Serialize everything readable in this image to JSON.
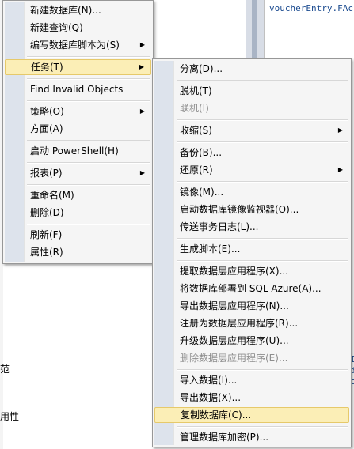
{
  "background": {
    "code_text": "voucherEntry.FAc",
    "left_fragments": [
      "范",
      "用性"
    ],
    "right_fragments": [
      "I",
      "d",
      "c"
    ]
  },
  "main_menu": {
    "items": [
      {
        "label": "新建数据库(N)...",
        "submenu": false
      },
      {
        "label": "新建查询(Q)",
        "submenu": false
      },
      {
        "label": "编写数据库脚本为(S)",
        "submenu": true
      },
      {
        "label": "任务(T)",
        "submenu": true,
        "highlighted": true
      },
      {
        "label": "Find Invalid Objects",
        "submenu": false
      },
      {
        "label": "策略(O)",
        "submenu": true
      },
      {
        "label": "方面(A)",
        "submenu": false
      },
      {
        "label": "启动 PowerShell(H)",
        "submenu": false
      },
      {
        "label": "报表(P)",
        "submenu": true
      },
      {
        "label": "重命名(M)",
        "submenu": false
      },
      {
        "label": "删除(D)",
        "submenu": false
      },
      {
        "label": "刷新(F)",
        "submenu": false
      },
      {
        "label": "属性(R)",
        "submenu": false
      }
    ]
  },
  "tasks_menu": {
    "items": [
      {
        "label": "分离(D)...",
        "enabled": true
      },
      {
        "label": "脱机(T)",
        "enabled": true
      },
      {
        "label": "联机(I)",
        "enabled": false
      },
      {
        "label": "收缩(S)",
        "enabled": true,
        "submenu": true
      },
      {
        "label": "备份(B)...",
        "enabled": true
      },
      {
        "label": "还原(R)",
        "enabled": true,
        "submenu": true
      },
      {
        "label": "镜像(M)...",
        "enabled": true
      },
      {
        "label": "启动数据库镜像监视器(O)...",
        "enabled": true
      },
      {
        "label": "传送事务日志(L)...",
        "enabled": true
      },
      {
        "label": "生成脚本(E)...",
        "enabled": true
      },
      {
        "label": "提取数据层应用程序(X)...",
        "enabled": true
      },
      {
        "label": "将数据库部署到 SQL Azure(A)...",
        "enabled": true
      },
      {
        "label": "导出数据层应用程序(N)...",
        "enabled": true
      },
      {
        "label": "注册为数据层应用程序(R)...",
        "enabled": true
      },
      {
        "label": "升级数据层应用程序(U)...",
        "enabled": true
      },
      {
        "label": "删除数据层应用程序(E)...",
        "enabled": false
      },
      {
        "label": "导入数据(I)...",
        "enabled": true
      },
      {
        "label": "导出数据(X)...",
        "enabled": true
      },
      {
        "label": "复制数据库(C)...",
        "enabled": true,
        "highlighted": true
      },
      {
        "label": "管理数据库加密(P)...",
        "enabled": true
      }
    ]
  },
  "arrow_glyph": "▶"
}
